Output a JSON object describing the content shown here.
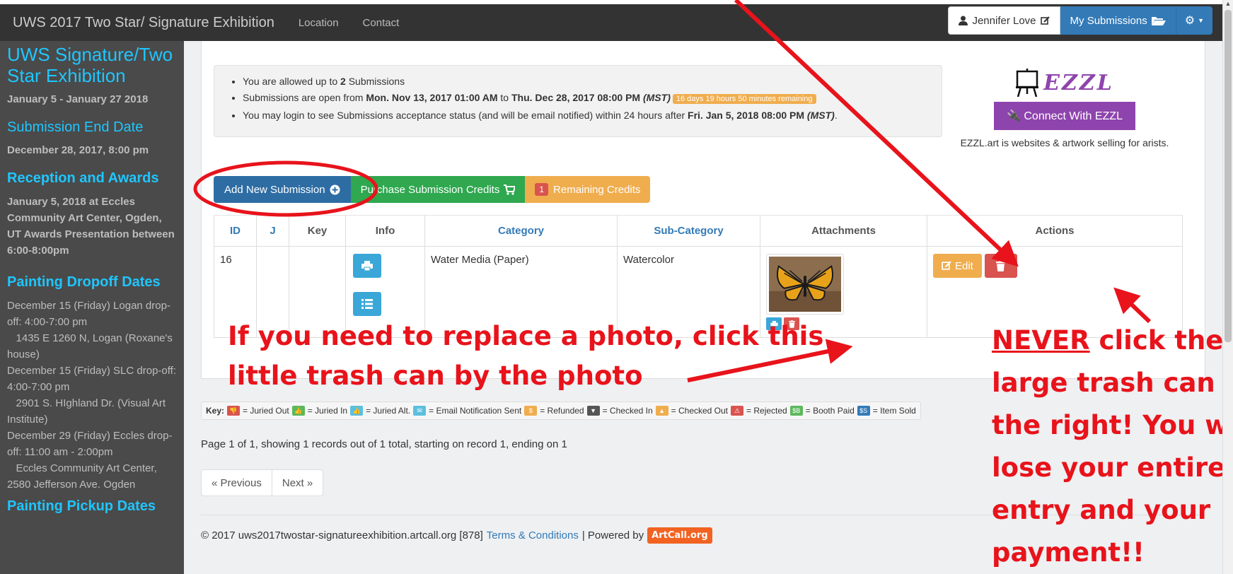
{
  "navbar": {
    "brand": "UWS 2017 Two Star/ Signature Exhibition",
    "links": [
      "Location",
      "Contact"
    ],
    "user": "Jennifer Love",
    "my_submissions": "My Submissions"
  },
  "sidebar": {
    "title": "UWS Signature/Two Star Exhibition",
    "dates": "January 5 - January 27 2018",
    "end_heading": "Submission End Date",
    "end_date": "December 28, 2017, 8:00 pm",
    "reception_heading": "Reception and Awards",
    "reception_text": "January 5, 2018 at Eccles Community Art Center, Ogden, UT Awards Presentation between 6:00-8:00pm",
    "dropoff_heading": "Painting Dropoff Dates",
    "dropoff_lines": [
      "December 15 (Friday) Logan drop-off:  4:00-7:00 pm",
      "   1435 E 1260 N, Logan (Roxane's house)",
      "December 15 (Friday) SLC drop-off: 4:00-7:00 pm",
      "   2901 S. HIghland Dr. (Visual Art Institute)",
      "December 29 (Friday) Eccles drop-off: 11:00 am - 2:00pm",
      "   Eccles Community Art Center, 2580 Jefferson Ave. Ogden"
    ],
    "pickup_heading": "Painting Pickup Dates"
  },
  "info": {
    "line1_pre": "You are allowed up to ",
    "line1_num": "2",
    "line1_post": " Submissions",
    "line2_pre": "Submissions are open from ",
    "line2_start": "Mon. Nov 13, 2017 01:00 AM",
    "line2_to": " to ",
    "line2_end": "Thu. Dec 28, 2017 08:00 PM",
    "line2_tz": "(MST)",
    "line2_badge": "16 days 19 hours 50 minutes remaining",
    "line3_pre": "You may login to see Submissions acceptance status (and will be email notified) within 24 hours after ",
    "line3_date": "Fri. Jan 5, 2018 08:00 PM",
    "line3_tz": "(MST)",
    "line3_post": "."
  },
  "ezzl": {
    "logo": "EZZL",
    "button": "Connect With EZZL",
    "desc": "EZZL.art is websites & artwork selling for arists."
  },
  "buttons": {
    "add": "Add New Submission",
    "purchase": "Purchase Submission Credits",
    "credits_count": "1",
    "credits_label": "Remaining Credits"
  },
  "table": {
    "headers": [
      "ID",
      "J",
      "Key",
      "Info",
      "Category",
      "Sub-Category",
      "Attachments",
      "Actions"
    ],
    "row": {
      "id": "16",
      "j": "",
      "key": "",
      "category": "Water Media (Paper)",
      "subcategory": "Watercolor",
      "edit": "Edit"
    }
  },
  "key_legend": {
    "label": "Key:",
    "items": [
      {
        "text": "= Juried Out",
        "color": "#d9534f",
        "icon": "thumbs-down-icon"
      },
      {
        "text": "= Juried In",
        "color": "#5cb85c",
        "icon": "thumbs-up-icon"
      },
      {
        "text": "= Juried Alt.",
        "color": "#5bc0de",
        "icon": "thumbs-alt-icon"
      },
      {
        "text": "= Email Notification Sent",
        "color": "#5bc0de",
        "icon": "envelope-icon"
      },
      {
        "text": "= Refunded",
        "color": "#f0ad4e",
        "icon": "dollar-icon",
        "glyph": "$"
      },
      {
        "text": "= Checked In",
        "color": "#555555",
        "icon": "checkin-icon"
      },
      {
        "text": "= Checked Out",
        "color": "#f0ad4e",
        "icon": "checkout-icon"
      },
      {
        "text": "= Rejected",
        "color": "#d9534f",
        "icon": "warning-icon"
      },
      {
        "text": "= Booth Paid",
        "color": "#5cb85c",
        "icon": "booth-paid-icon",
        "glyph": "$B"
      },
      {
        "text": "= Item Sold",
        "color": "#337ab7",
        "icon": "item-sold-icon",
        "glyph": "$S"
      }
    ]
  },
  "paging": {
    "info": "Page 1 of 1, showing 1 records out of 1 total, starting on record 1, ending on 1",
    "prev": "« Previous",
    "next": "Next »"
  },
  "footer": {
    "copyright": "© 2017 uws2017twostar-signatureexhibition.artcall.org [878]",
    "terms": "Terms & Conditions",
    "sep": "| Powered by",
    "logo": "ArtCall.org"
  },
  "annotations": {
    "left": "If you need to replace a photo, click this little trash can by the photo",
    "right_never": "NEVER",
    "right_rest1": " click the",
    "right_lines": [
      "large trash can on",
      "the right! You will",
      "lose your entire",
      "entry and your",
      "payment!!"
    ]
  },
  "colors": {
    "accent_blue": "#337ab7",
    "sidebar_heading": "#1fc6ff",
    "annotation_red": "#e8131b",
    "ezzl_purple": "#8e44ad"
  }
}
